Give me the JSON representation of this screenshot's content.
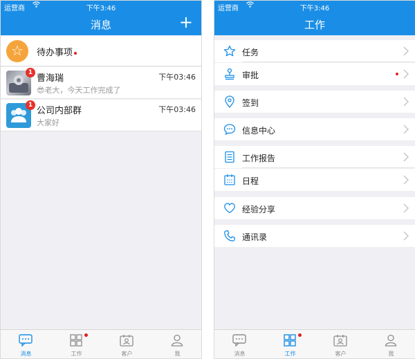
{
  "colors": {
    "brand": "#1a8ee6",
    "badge": "#e8302a",
    "todo": "#f5a43c"
  },
  "status": {
    "carrier": "运营商",
    "time": "下午3:46"
  },
  "messages_screen": {
    "title": "消息",
    "add_icon": "plus-icon",
    "todo_label": "待办事项",
    "conversations": [
      {
        "name": "曹海瑞",
        "time": "下午03:46",
        "preview": "😎老大，今天工作完成了",
        "badge": "1"
      },
      {
        "name": "公司内部群",
        "time": "下午03:46",
        "preview": "大家好",
        "badge": "1"
      }
    ]
  },
  "work_screen": {
    "title": "工作",
    "items": [
      {
        "label": "任务",
        "icon": "star-icon"
      },
      {
        "label": "审批",
        "icon": "stamp-icon"
      },
      {
        "label": "签到",
        "icon": "location-pin-icon"
      },
      {
        "label": "信息中心",
        "icon": "chat-bubble-icon"
      },
      {
        "label": "工作报告",
        "icon": "document-icon"
      },
      {
        "label": "日程",
        "icon": "calendar-icon"
      },
      {
        "label": "经验分享",
        "icon": "heart-icon"
      },
      {
        "label": "通讯录",
        "icon": "phone-icon"
      }
    ]
  },
  "tabbar": [
    {
      "label": "消息",
      "icon": "message-icon"
    },
    {
      "label": "工作",
      "icon": "grid-icon"
    },
    {
      "label": "客户",
      "icon": "contact-card-icon"
    },
    {
      "label": "我",
      "icon": "person-icon"
    }
  ]
}
